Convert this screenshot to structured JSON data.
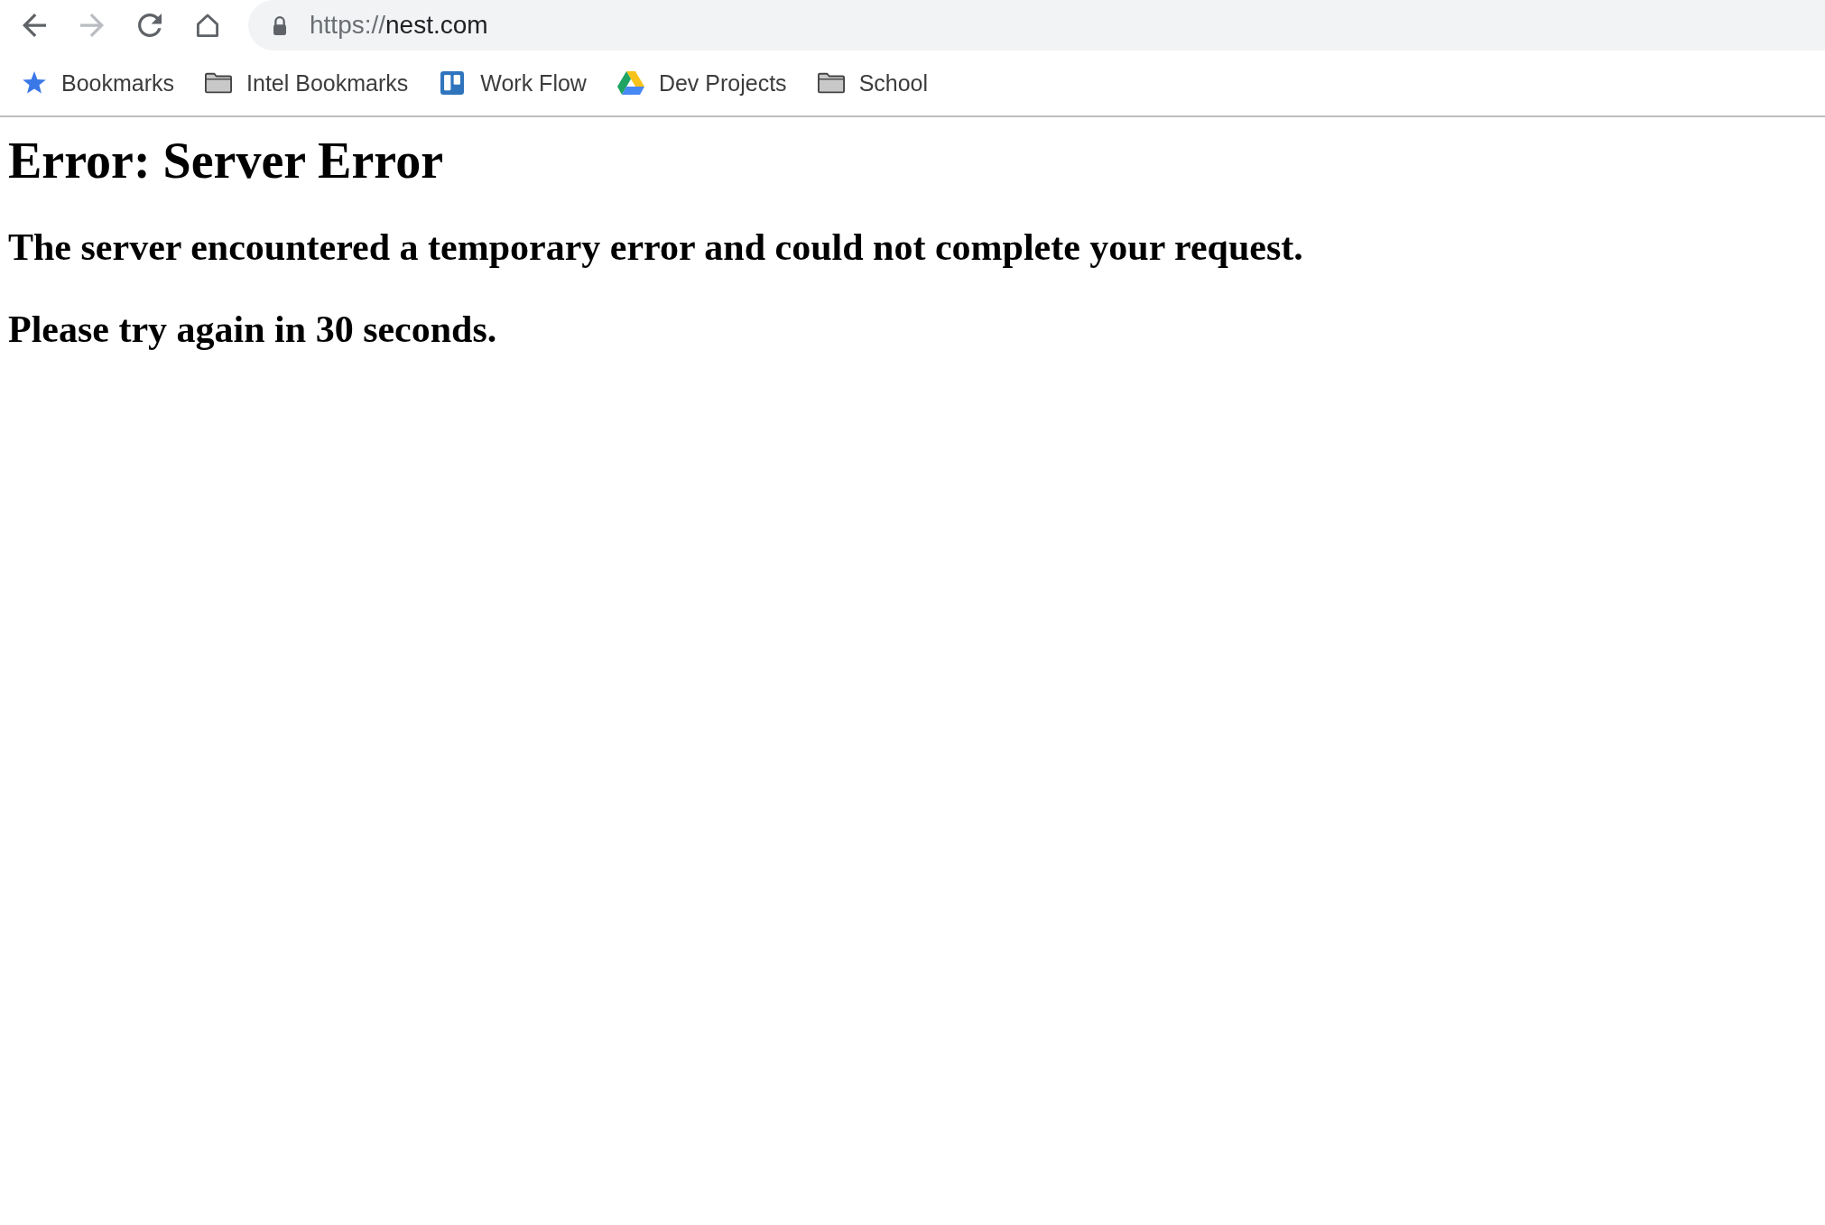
{
  "toolbar": {
    "nav_buttons": [
      {
        "kind": "back",
        "disabled": false
      },
      {
        "kind": "forward",
        "disabled": true
      },
      {
        "kind": "reload",
        "disabled": false
      },
      {
        "kind": "home",
        "disabled": false
      }
    ],
    "address_bar": {
      "scheme": "https://",
      "host": "nest.com"
    }
  },
  "bookmarks_bar": {
    "items": [
      {
        "kind": "star",
        "label": "Bookmarks"
      },
      {
        "kind": "folder",
        "label": "Intel Bookmarks"
      },
      {
        "kind": "board",
        "label": "Work Flow"
      },
      {
        "kind": "drive",
        "label": "Dev Projects"
      },
      {
        "kind": "folder",
        "label": "School"
      }
    ]
  },
  "page": {
    "heading": "Error: Server Error",
    "messages": [
      "The server encountered a temporary error and could not complete your request.",
      "Please try again in 30 seconds."
    ]
  }
}
